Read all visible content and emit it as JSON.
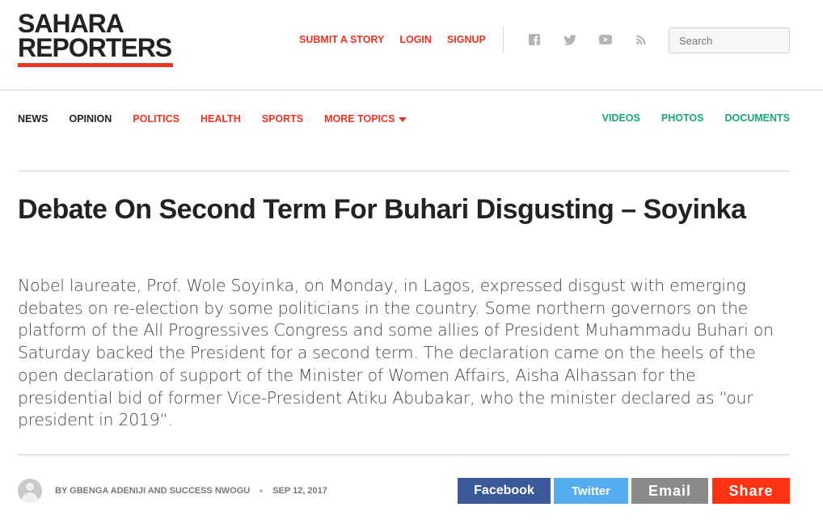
{
  "header": {
    "logo_line1": "SAHARA",
    "logo_line2": "REPORTERS",
    "links": [
      "SUBMIT A STORY",
      "LOGIN",
      "SIGNUP"
    ],
    "social_icons": [
      "facebook-icon",
      "twitter-icon",
      "youtube-icon",
      "rss-icon"
    ],
    "search_placeholder": "Search"
  },
  "nav": {
    "left": [
      {
        "label": "NEWS",
        "color": "#222222"
      },
      {
        "label": "OPINION",
        "color": "#222222"
      },
      {
        "label": "POLITICS",
        "color": "#ee3322"
      },
      {
        "label": "HEALTH",
        "color": "#ee3322"
      },
      {
        "label": "SPORTS",
        "color": "#ee3322"
      },
      {
        "label": "MORE TOPICS",
        "color": "#ee3322"
      }
    ],
    "right": [
      "VIDEOS",
      "PHOTOS",
      "DOCUMENTS"
    ]
  },
  "article": {
    "title": "Debate On Second Term For Buhari Disgusting – Soyinka",
    "summary": "Nobel laureate, Prof. Wole Soyinka, on Monday, in Lagos, expressed disgust with emerging debates on re-election by some politicians in the country. Some northern governors on the platform of the All Progressives Congress and some allies of President Muhammadu Buhari on Saturday backed the President for a second term. The declaration came on the heels of the open declaration of support of the Minister of Women Affairs, Aisha Alhassan for the presidential bid of former Vice-President Atiku Abubakar, who the minister declared as “our president in 2019“.",
    "byline": "BY GBENGA ADENIJI AND SUCCESS NWOGU",
    "date": "SEP 12, 2017"
  },
  "share": {
    "facebook": "Facebook",
    "twitter": "Twitter",
    "email": "Email",
    "share": "Share"
  },
  "colors": {
    "accent_red": "#ee3322",
    "accent_green": "#1aa57a",
    "facebook_blue": "#3b5998",
    "twitter_blue": "#55acee",
    "email_gray": "#8a8a8a",
    "share_red": "#ff3311"
  }
}
